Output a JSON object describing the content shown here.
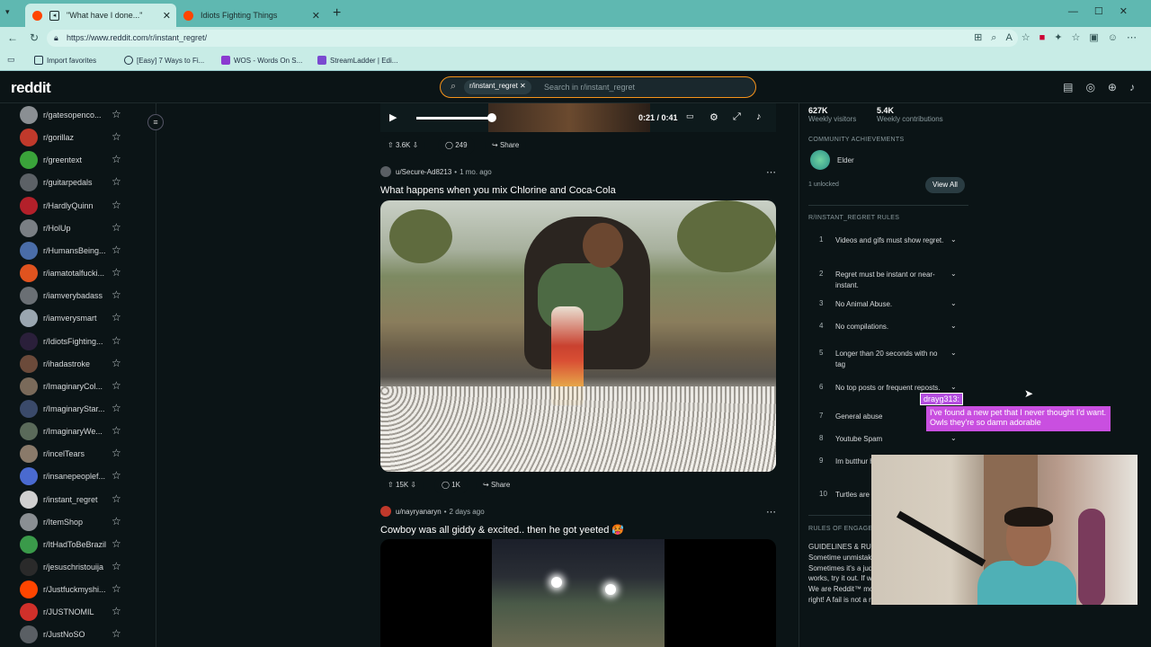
{
  "browser": {
    "tabs": [
      {
        "title": "\"What have I done...\""
      },
      {
        "title": "Idiots Fighting Things"
      }
    ],
    "url": "https://www.reddit.com/r/instant_regret/",
    "bookmarks": [
      "Import favorites",
      "[Easy] 7 Ways to Fi...",
      "WOS - Words On S...",
      "StreamLadder | Edi..."
    ]
  },
  "header": {
    "logo": "reddit",
    "search_chip": "r/instant_regret",
    "search_placeholder": "Search in r/instant_regret"
  },
  "sidebar": {
    "items": [
      {
        "name": "r/gatesopenco...",
        "color": "#8a8f93"
      },
      {
        "name": "r/gorillaz",
        "color": "#c0392b"
      },
      {
        "name": "r/greentext",
        "color": "#3aa33a"
      },
      {
        "name": "r/guitarpedals",
        "color": "#5c6166"
      },
      {
        "name": "r/HardlyQuinn",
        "color": "#b3202a"
      },
      {
        "name": "r/HolUp",
        "color": "#7a7f84"
      },
      {
        "name": "r/HumansBeing...",
        "color": "#4a6da8"
      },
      {
        "name": "r/iamatotalfucki...",
        "color": "#e0531f"
      },
      {
        "name": "r/iamverybadass",
        "color": "#6a6f74"
      },
      {
        "name": "r/iamverysmart",
        "color": "#9aa6b0"
      },
      {
        "name": "r/IdiotsFighting...",
        "color": "#2a1f3a"
      },
      {
        "name": "r/ihadastroke",
        "color": "#6b4a3a"
      },
      {
        "name": "r/ImaginaryCol...",
        "color": "#7a6a5a"
      },
      {
        "name": "r/ImaginaryStar...",
        "color": "#3a4a6a"
      },
      {
        "name": "r/ImaginaryWe...",
        "color": "#5a6a5a"
      },
      {
        "name": "r/incelTears",
        "color": "#8a7a6a"
      },
      {
        "name": "r/insanepeoplef...",
        "color": "#4a6ad0"
      },
      {
        "name": "r/instant_regret",
        "color": "#d0d0d0"
      },
      {
        "name": "r/ItemShop",
        "color": "#8a8f93"
      },
      {
        "name": "r/ItHadToBeBrazil",
        "color": "#3a9a4a"
      },
      {
        "name": "r/jesuschristouija",
        "color": "#2a2a2a"
      },
      {
        "name": "r/Justfuckmyshi...",
        "color": "#ff4500"
      },
      {
        "name": "r/JUSTNOMIL",
        "color": "#d0302a"
      },
      {
        "name": "r/JustNoSO",
        "color": "#5a5f64"
      }
    ]
  },
  "video_player": {
    "time": "0:21 / 0:41",
    "progress": 0.51
  },
  "post0_actions": {
    "votes": "3.6K",
    "comments": "249",
    "share": "Share"
  },
  "post1": {
    "author": "u/Secure-Ad8213",
    "age": "1 mo. ago",
    "title": "What happens when you mix Chlorine and Coca-Cola",
    "votes": "15K",
    "comments": "1K",
    "share": "Share"
  },
  "post2": {
    "author": "u/nayryanaryn",
    "age": "2 days ago",
    "title": "Cowboy was all giddy & excited.. then he got yeeted 🥵"
  },
  "right_sidebar": {
    "weekly_visitors_value": "627K",
    "weekly_visitors_label": "Weekly visitors",
    "weekly_contrib_value": "5.4K",
    "weekly_contrib_label": "Weekly contributions",
    "achievements_heading": "COMMUNITY ACHIEVEMENTS",
    "achievement": "Elder",
    "unlocked": "1 unlocked",
    "view_all": "View All",
    "rules_heading": "R/INSTANT_REGRET RULES",
    "rules": [
      {
        "num": "1",
        "text": "Videos and gifs must show regret."
      },
      {
        "num": "2",
        "text": "Regret must be instant or near-instant."
      },
      {
        "num": "3",
        "text": "No Animal Abuse."
      },
      {
        "num": "4",
        "text": "No compilations."
      },
      {
        "num": "5",
        "text": "Longer than 20 seconds with no tag"
      },
      {
        "num": "6",
        "text": "No top posts or frequent reposts."
      },
      {
        "num": "7",
        "text": "General abuse"
      },
      {
        "num": "8",
        "text": "Youtube Spam"
      },
      {
        "num": "9",
        "text": "Im butthur has more l"
      },
      {
        "num": "10",
        "text": "Turtles are"
      }
    ],
    "engagement_heading": "RULES OF ENGAGEM",
    "engagement_text": "GUIDELINES & RU must show regret. frames. Sometime unmistakable. It ca someone's face, o Sometimes it's a judgment call. If you think it works, try it out. If we delete it, you were wrong. We are Reddit™ moderators. We are always right! A fail is not a regret. Some"
  },
  "chat_overlay": {
    "username": "drayg313:",
    "message": "I've found a new pet that I never thought I'd want. Owls they're so damn adorable"
  }
}
